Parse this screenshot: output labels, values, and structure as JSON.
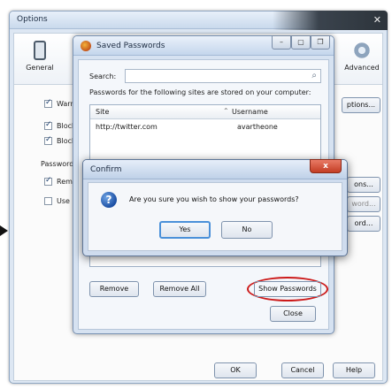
{
  "options_window": {
    "title": "Options",
    "toolbar": [
      {
        "label": "General",
        "icon": "phone-icon"
      },
      {
        "label": "Advanced",
        "icon": "gear-icon"
      }
    ],
    "side_rows": [
      {
        "label": "Warn",
        "checked": true
      },
      {
        "label": "Block",
        "checked": true
      },
      {
        "label": "Block",
        "checked": true
      },
      {
        "label": "Passwords",
        "is_heading": true
      },
      {
        "label": "Reme",
        "checked": true
      },
      {
        "label": "Use a",
        "checked": false
      }
    ],
    "right_buttons": [
      "ptions...",
      "ons...",
      "word...",
      "ord..."
    ],
    "footer_buttons": {
      "ok": "OK",
      "cancel": "Cancel",
      "help": "Help"
    }
  },
  "saved_passwords": {
    "title": "Saved Passwords",
    "search_label": "Search:",
    "search_value": "",
    "info": "Passwords for the following sites are stored on your computer:",
    "columns": {
      "site": "Site",
      "username": "Username"
    },
    "rows": [
      {
        "site": "http://twitter.com",
        "username": "avartheone"
      }
    ],
    "buttons": {
      "remove": "Remove",
      "remove_all": "Remove All",
      "show_passwords": "Show Passwords",
      "close": "Close"
    },
    "highlight_color": "#cc1a1a"
  },
  "confirm": {
    "title": "Confirm",
    "message": "Are you sure you wish to show your passwords?",
    "yes": "Yes",
    "no": "No",
    "close_glyph": "x"
  }
}
